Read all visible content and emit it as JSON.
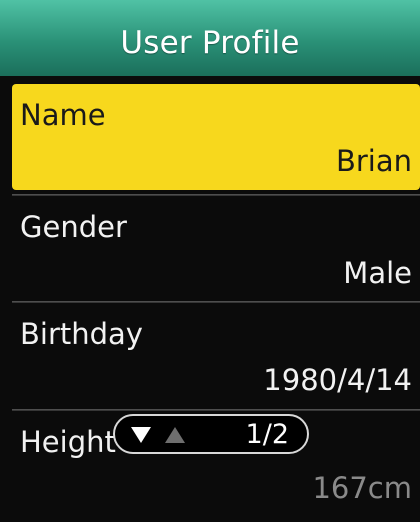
{
  "header": {
    "title": "User Profile"
  },
  "fields": [
    {
      "label": "Name",
      "value": "Brian"
    },
    {
      "label": "Gender",
      "value": "Male"
    },
    {
      "label": "Birthday",
      "value": "1980/4/14"
    },
    {
      "label": "Height",
      "value": "167cm"
    }
  ],
  "pager": {
    "page": "1/2"
  },
  "colors": {
    "header": "#2a9177",
    "selected": "#f7d81d",
    "background": "#0b0b0b"
  },
  "icons": {
    "down": "triangle-down-icon",
    "up": "triangle-up-icon"
  }
}
